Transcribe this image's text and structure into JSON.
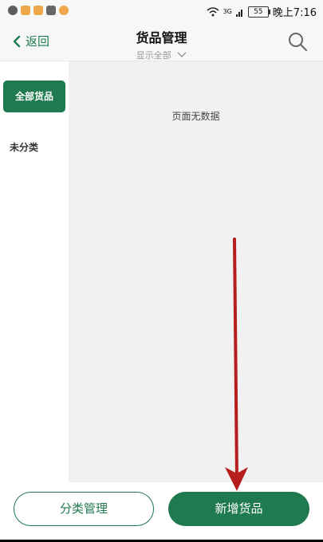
{
  "status_bar": {
    "time": "晚上7:16",
    "battery": "55",
    "network": "3G"
  },
  "header": {
    "back_label": "返回",
    "title": "货品管理",
    "filter_label": "显示全部"
  },
  "sidebar": {
    "items": [
      {
        "label": "全部货品"
      },
      {
        "label": "未分类"
      }
    ]
  },
  "main": {
    "empty_text": "页面无数据"
  },
  "bottom": {
    "category_button": "分类管理",
    "add_button": "新增货品"
  },
  "colors": {
    "brand": "#1f7a4f",
    "arrow": "#b61d1d"
  }
}
